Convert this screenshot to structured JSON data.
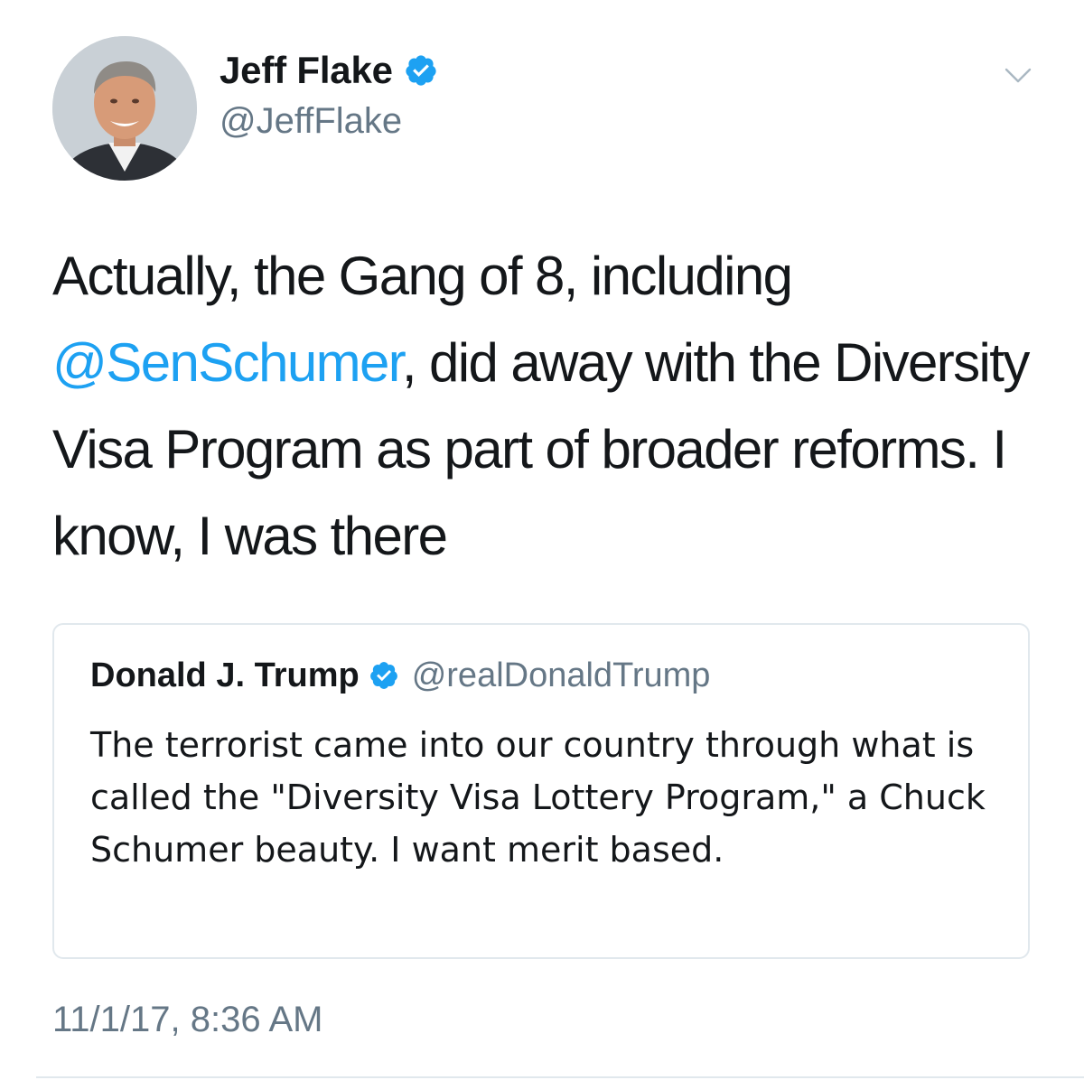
{
  "author": {
    "display_name": "Jeff Flake",
    "handle": "@JeffFlake",
    "verified": true,
    "avatar_icon": "profile-photo"
  },
  "tweet": {
    "text_before": "Actually, the Gang of 8, including ",
    "mention": "@SenSchumer",
    "text_after": ", did away with the Diversity Visa Program as part of broader reforms. I know, I was there",
    "timestamp": "11/1/17, 8:36 AM"
  },
  "quoted_tweet": {
    "display_name": "Donald J. Trump",
    "handle": "@realDonaldTrump",
    "verified": true,
    "text": "The terrorist came into our country through what is called the \"Diversity Visa Lottery Program,\" a Chuck Schumer beauty. I want merit based."
  },
  "icons": {
    "verified": "verified-badge-icon",
    "menu": "chevron-down-icon"
  },
  "colors": {
    "accent": "#1da1f2",
    "text": "#14171a",
    "muted": "#657786",
    "border": "#e1e8ed"
  }
}
